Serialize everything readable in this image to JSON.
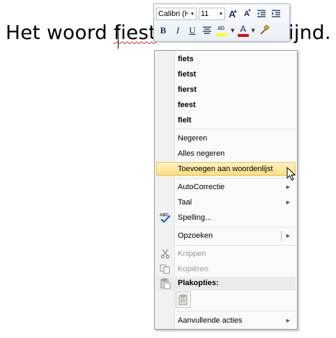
{
  "document": {
    "before": "Het woord ",
    "misspelled": "fiest",
    "after": " wordt onderlijnd."
  },
  "mini_toolbar": {
    "font_name": "Calibri (H",
    "font_size": "11",
    "grow_font": "A",
    "shrink_font": "A",
    "bold": "B",
    "italic": "I",
    "underline": "U",
    "highlight_label": "ab",
    "font_color_label": "A",
    "highlight_color": "#ffff00",
    "font_color": "#e00000"
  },
  "context_menu": {
    "suggestions": [
      "fiets",
      "fietst",
      "fierst",
      "feest",
      "fielt"
    ],
    "ignore": "Negeren",
    "ignore_all": "Alles negeren",
    "add_to_dictionary": "Toevoegen aan woordenlijst",
    "autocorrect": "AutoCorrectie",
    "language": "Taal",
    "spelling": "Spelling...",
    "lookup": "Opzoeken",
    "cut": "Knippen",
    "copy": "Kopiëren",
    "paste_options": "Plakopties:",
    "additional_actions": "Aanvullende acties"
  }
}
